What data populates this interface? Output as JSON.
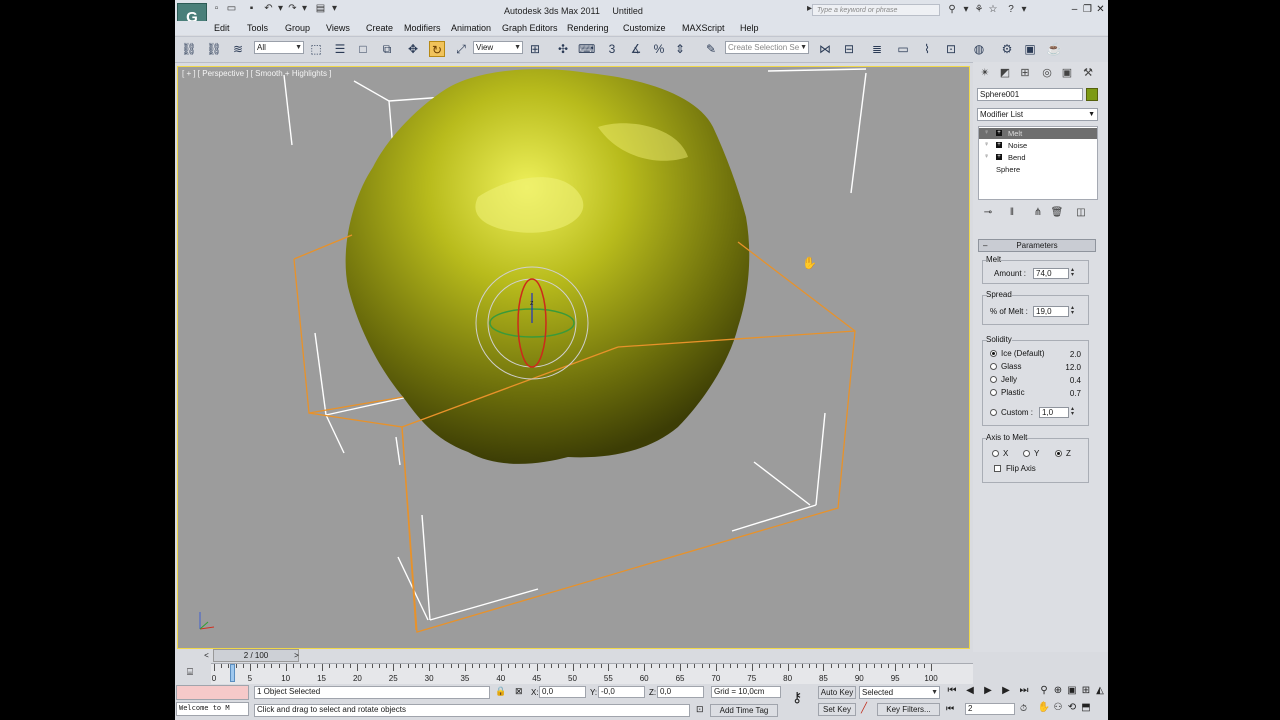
{
  "app": {
    "title": "Autodesk 3ds Max 2011",
    "document": "Untitled",
    "logo_text": "G",
    "search_placeholder": "Type a keyword or phrase",
    "window_controls": [
      "minimize-icon",
      "restore-icon",
      "close-icon"
    ]
  },
  "menu": [
    "Edit",
    "Tools",
    "Group",
    "Views",
    "Create",
    "Modifiers",
    "Animation",
    "Graph Editors",
    "Rendering",
    "Customize",
    "MAXScript",
    "Help"
  ],
  "toolbar": {
    "filter_value": "All",
    "refcoord_value": "View",
    "snap_label": "3",
    "selection_set_placeholder": "Create Selection Se"
  },
  "viewport": {
    "label": "[ + ] [ Perspective ] [ Smooth + Highlights ]",
    "gizmo_axis": "z",
    "object_color": "#a7b10f"
  },
  "command_panel": {
    "object_name": "Sphere001",
    "object_color": "#7c9a14",
    "modifier_list_label": "Modifier List",
    "stack": [
      {
        "name": "Melt",
        "selected": true,
        "has_toggle": true
      },
      {
        "name": "Noise",
        "selected": false,
        "has_toggle": true
      },
      {
        "name": "Bend",
        "selected": false,
        "has_toggle": true
      },
      {
        "name": "Sphere",
        "selected": false,
        "has_toggle": false
      }
    ],
    "rollout_title": "Parameters",
    "melt": {
      "group_label": "Melt",
      "amount_label": "Amount :",
      "amount_value": "74,0"
    },
    "spread": {
      "group_label": "Spread",
      "percent_label": "% of Melt :",
      "percent_value": "19,0"
    },
    "solidity": {
      "group_label": "Solidity",
      "options": [
        {
          "label": "Ice (Default)",
          "value": "2.0",
          "selected": true
        },
        {
          "label": "Glass",
          "value": "12.0",
          "selected": false
        },
        {
          "label": "Jelly",
          "value": "0.4",
          "selected": false
        },
        {
          "label": "Plastic",
          "value": "0.7",
          "selected": false
        }
      ],
      "custom_label": "Custom :",
      "custom_value": "1,0"
    },
    "axis": {
      "group_label": "Axis to Melt",
      "options": [
        {
          "label": "X",
          "selected": false
        },
        {
          "label": "Y",
          "selected": false
        },
        {
          "label": "Z",
          "selected": true
        }
      ],
      "flip_label": "Flip Axis"
    }
  },
  "timeline": {
    "frame_display": "2 / 100",
    "ticks": [
      "0",
      "5",
      "10",
      "15",
      "20",
      "25",
      "30",
      "35",
      "40",
      "45",
      "50",
      "55",
      "60",
      "65",
      "70",
      "75",
      "80",
      "85",
      "90",
      "95",
      "100"
    ]
  },
  "status": {
    "maxscript_text": "Welcome to M",
    "selection_text": "1 Object Selected",
    "prompt_text": "Click and drag to select and rotate objects",
    "x_label": "X:",
    "x_value": "0,0",
    "y_label": "Y:",
    "y_value": "-0,0",
    "z_label": "Z:",
    "z_value": "0,0",
    "grid_text": "Grid = 10,0cm",
    "add_time_tag": "Add Time Tag",
    "auto_key": "Auto Key",
    "set_key": "Set Key",
    "key_mode_value": "Selected",
    "key_filters": "Key Filters...",
    "current_frame": "2"
  }
}
